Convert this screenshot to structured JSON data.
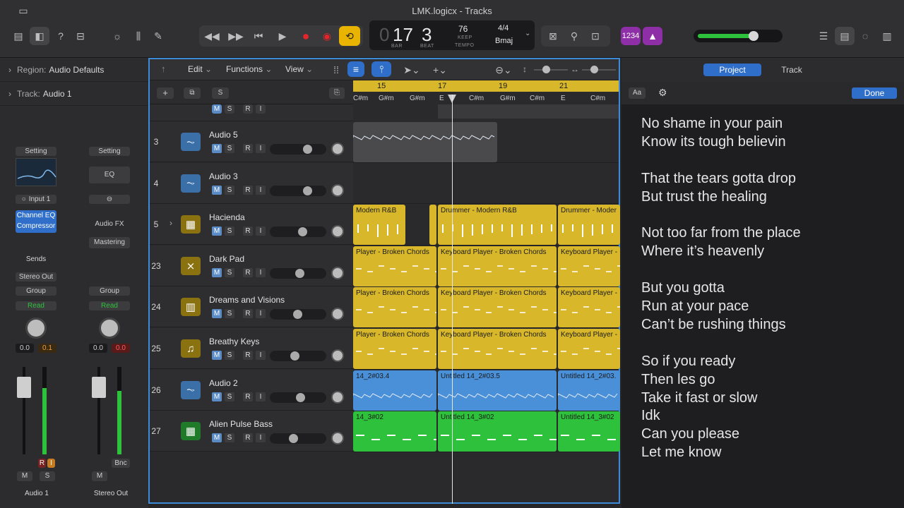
{
  "window": {
    "title": "LMK.logicx - Tracks"
  },
  "lcd": {
    "bar": "17",
    "beat": "3",
    "bar_label": "BAR",
    "beat_label": "BEAT",
    "tempo": "76",
    "keep_label": "KEEP",
    "tempo_label": "TEMPO",
    "signature": "4/4",
    "key": "Bmaj"
  },
  "toolbar": {
    "count_in": "1234"
  },
  "inspector": {
    "region_label": "Region:",
    "region_value": "Audio Defaults",
    "track_label": "Track:",
    "track_value": "Audio 1",
    "strip1": {
      "setting": "Setting",
      "input": "Input 1",
      "plugins": [
        "Channel EQ",
        "Compressor"
      ],
      "sends": "Sends",
      "output": "Stereo Out",
      "group": "Group",
      "automation": "Read",
      "vol": "0.0",
      "pan": "0.1",
      "ri_r": "R",
      "ri_i": "I",
      "m": "M",
      "s": "S",
      "name": "Audio 1"
    },
    "strip2": {
      "setting": "Setting",
      "eq": "EQ",
      "fx": "Audio FX",
      "mastering": "Mastering",
      "group": "Group",
      "automation": "Read",
      "vol": "0.0",
      "pan": "0.0",
      "bnc": "Bnc",
      "m": "M",
      "name": "Stereo Out"
    }
  },
  "tracks_toolbar": {
    "edit": "Edit",
    "functions": "Functions",
    "view": "View"
  },
  "header_buttons": {
    "s": "S"
  },
  "ruler": {
    "bars": [
      "15",
      "17",
      "19",
      "21"
    ],
    "chords": [
      "C#m",
      "G#m",
      "G#m",
      "E",
      "C#m",
      "G#m",
      "C#m",
      "E",
      "C#m"
    ]
  },
  "tracks": [
    {
      "num": "3",
      "name": "Audio 5",
      "color": "#4a90d9",
      "icon": "waveform-icon",
      "volume": 0.7
    },
    {
      "num": "4",
      "name": "Audio 3",
      "color": "#4a90d9",
      "icon": "waveform-icon",
      "volume": 0.7
    },
    {
      "num": "5",
      "name": "Hacienda",
      "color": "#d8b82a",
      "icon": "drum-machine-icon",
      "volume": 0.6
    },
    {
      "num": "23",
      "name": "Dark Pad",
      "color": "#d8b82a",
      "icon": "synth-pad-icon",
      "volume": 0.53
    },
    {
      "num": "24",
      "name": "Dreams and Visions",
      "color": "#d8b82a",
      "icon": "keyboard-icon",
      "volume": 0.49
    },
    {
      "num": "25",
      "name": "Breathy Keys",
      "color": "#d8b82a",
      "icon": "keys-icon",
      "volume": 0.44
    },
    {
      "num": "26",
      "name": "Audio 2",
      "color": "#4a90d9",
      "icon": "waveform-icon",
      "volume": 0.55
    },
    {
      "num": "27",
      "name": "Alien Pulse Bass",
      "color": "#2ec23c",
      "icon": "synth-icon",
      "volume": 0.4
    }
  ],
  "track_buttons": {
    "m": "M",
    "s": "S",
    "r": "R",
    "i": "I"
  },
  "regions": {
    "drummer1": "Modern R&B",
    "drummer2": "Drummer - Modern R&B",
    "drummer3": "Drummer - Moder",
    "kp1": "Player - Broken Chords",
    "kp2": "Keyboard Player - Broken Chords",
    "kp3": "Keyboard Player -",
    "a2_1": "14_2#03.4",
    "a2_2": "Untitled 14_2#03.5",
    "a2_3": "Untitled 14_2#03.",
    "b1": "14_3#02",
    "b2": "Untitled 14_3#02",
    "b3": "Untitled 14_3#02"
  },
  "panel": {
    "tab_project": "Project",
    "tab_track": "Track",
    "aa": "Aa",
    "done": "Done"
  },
  "lyrics": [
    "No shame in your pain",
    "Know its tough believin",
    "",
    "That the tears gotta drop",
    "But trust the healing",
    "",
    "Not too far from the place",
    "Where it’s heavenly",
    "",
    "But you gotta",
    "Run at your pace",
    "Can’t be rushing things",
    "",
    "So if you ready",
    "Then les go",
    "Take it fast or slow",
    "Idk",
    "Can you please",
    "Let me know"
  ],
  "colors": {
    "accent": "#3d8ad6",
    "drummer": "#d8b82a",
    "audio": "#4a90d9",
    "bass": "#2ec23c",
    "record": "#e0262a",
    "cycle": "#e8b400"
  }
}
